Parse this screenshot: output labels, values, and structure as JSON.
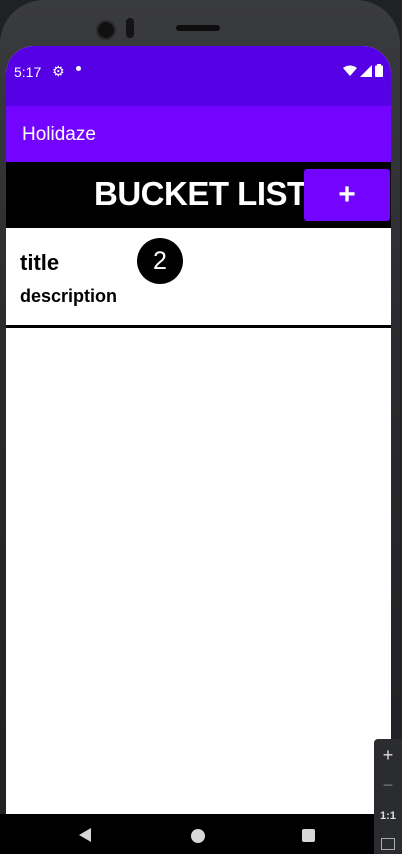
{
  "status_bar": {
    "time": "5:17",
    "icons": [
      "gear-icon",
      "notification-dot-icon",
      "wifi-icon",
      "signal-icon",
      "battery-icon"
    ]
  },
  "app_bar": {
    "title": "Holidaze"
  },
  "header": {
    "title": "BUCKET LIST",
    "add_label": "+"
  },
  "list": {
    "items": [
      {
        "title": "title",
        "description": "description",
        "badge": "2"
      }
    ]
  },
  "navigation": {
    "buttons": [
      "back-icon",
      "home-icon",
      "recents-icon"
    ]
  },
  "zoom_controls": {
    "plus": "+",
    "minus": "−",
    "ratio": "1:1"
  },
  "colors": {
    "status_bar": "#5500e5",
    "app_bar": "#7204ff",
    "accent": "#7204ff",
    "header_bg": "#000000"
  }
}
